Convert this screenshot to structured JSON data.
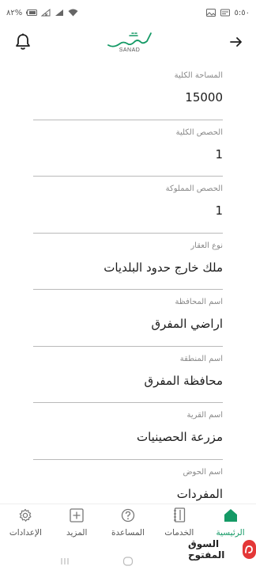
{
  "status_bar": {
    "time": "٥:٥٠",
    "battery": "٨٢%"
  },
  "header": {
    "logo_text": "سند",
    "brand": "SANAD",
    "icons": [
      "bell-icon",
      "arrow-right-icon"
    ]
  },
  "fields": [
    {
      "label": "المساحة الكلية",
      "value": "15000"
    },
    {
      "label": "الحصص الكلية",
      "value": "1"
    },
    {
      "label": "الحصص المملوكة",
      "value": "1"
    },
    {
      "label": "نوع العقار",
      "value": "ملك خارج حدود البلديات"
    },
    {
      "label": "اسم المحافظة",
      "value": "اراضي المفرق"
    },
    {
      "label": "اسم المنطقة",
      "value": "محافظة المفرق"
    },
    {
      "label": "اسم القرية",
      "value": "مزرعة الحصينيات"
    },
    {
      "label": "اسم الحوض",
      "value": "المفردات"
    }
  ],
  "nav": {
    "items": [
      {
        "label": "الرئيسية",
        "icon": "home-icon",
        "active": true
      },
      {
        "label": "الخدمات",
        "icon": "services-icon",
        "active": false
      },
      {
        "label": "المساعدة",
        "icon": "help-icon",
        "active": false
      },
      {
        "label": "المزيد",
        "icon": "plus-square-icon",
        "active": false
      },
      {
        "label": "الإعدادات",
        "icon": "gear-icon",
        "active": false
      }
    ]
  },
  "watermark": {
    "opensooq_text": "السوق المفتوح"
  },
  "colors": {
    "accent": "#159a66",
    "divider": "#b9b9b9",
    "label": "#8a8a8a"
  }
}
